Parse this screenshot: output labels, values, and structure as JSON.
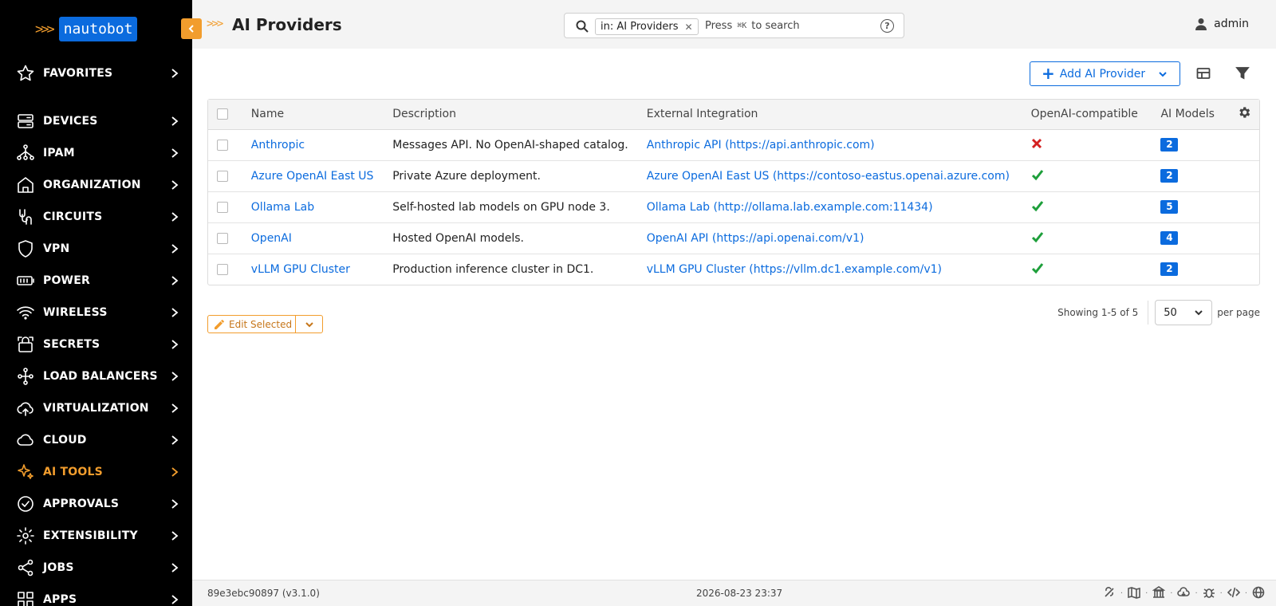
{
  "logo": {
    "chevrons": ">>>",
    "text": "nautobot"
  },
  "sidebar": {
    "items": [
      {
        "label": "FAVORITES",
        "icon": "star-icon"
      },
      {
        "label": "DEVICES",
        "icon": "server-icon"
      },
      {
        "label": "IPAM",
        "icon": "network-icon"
      },
      {
        "label": "ORGANIZATION",
        "icon": "building-icon"
      },
      {
        "label": "CIRCUITS",
        "icon": "circuit-icon"
      },
      {
        "label": "VPN",
        "icon": "shield-icon"
      },
      {
        "label": "POWER",
        "icon": "battery-icon"
      },
      {
        "label": "WIRELESS",
        "icon": "wifi-icon"
      },
      {
        "label": "SECRETS",
        "icon": "lock-icon"
      },
      {
        "label": "LOAD BALANCERS",
        "icon": "balance-icon"
      },
      {
        "label": "VIRTUALIZATION",
        "icon": "cloud-upload-icon"
      },
      {
        "label": "CLOUD",
        "icon": "cloud-icon"
      },
      {
        "label": "AI TOOLS",
        "icon": "sparkle-icon",
        "active": true
      },
      {
        "label": "APPROVALS",
        "icon": "check-circle-icon"
      },
      {
        "label": "EXTENSIBILITY",
        "icon": "gear-icon"
      },
      {
        "label": "JOBS",
        "icon": "share-nodes-icon"
      },
      {
        "label": "APPS",
        "icon": "grid-icon"
      }
    ]
  },
  "header": {
    "chevrons": ">>>",
    "title": "AI Providers",
    "search": {
      "chip": "in: AI Providers",
      "press": "Press",
      "shortcut": "⌘K",
      "suffix": "to search"
    },
    "user": "admin"
  },
  "toolbar": {
    "add_label": "Add AI Provider"
  },
  "table": {
    "columns": [
      "Name",
      "Description",
      "External Integration",
      "OpenAI-compatible",
      "AI Models"
    ],
    "rows": [
      {
        "name": "Anthropic",
        "description": "Messages API. No OpenAI-shaped catalog.",
        "integration": "Anthropic API (https://api.anthropic.com)",
        "openai_compatible": false,
        "models": "2"
      },
      {
        "name": "Azure OpenAI East US",
        "description": "Private Azure deployment.",
        "integration": "Azure OpenAI East US (https://contoso-eastus.openai.azure.com)",
        "openai_compatible": true,
        "models": "2"
      },
      {
        "name": "Ollama Lab",
        "description": "Self-hosted lab models on GPU node 3.",
        "integration": "Ollama Lab (http://ollama.lab.example.com:11434)",
        "openai_compatible": true,
        "models": "5"
      },
      {
        "name": "OpenAI",
        "description": "Hosted OpenAI models.",
        "integration": "OpenAI API (https://api.openai.com/v1)",
        "openai_compatible": true,
        "models": "4"
      },
      {
        "name": "vLLM GPU Cluster",
        "description": "Production inference cluster in DC1.",
        "integration": "vLLM GPU Cluster (https://vllm.dc1.example.com/v1)",
        "openai_compatible": true,
        "models": "2"
      }
    ]
  },
  "bulk": {
    "edit_label": "Edit Selected"
  },
  "paging": {
    "showing": "Showing 1-5 of 5",
    "per_page_value": "50",
    "per_page_label": "per page"
  },
  "footer": {
    "version": "89e3ebc90897 (v3.1.0)",
    "timestamp": "2026-08-23 23:37"
  },
  "colors": {
    "accent": "#f29d2d",
    "primary": "#0b6bde",
    "sidebar_bg": "#000000",
    "success": "#1e9f3b",
    "danger": "#d42020"
  }
}
